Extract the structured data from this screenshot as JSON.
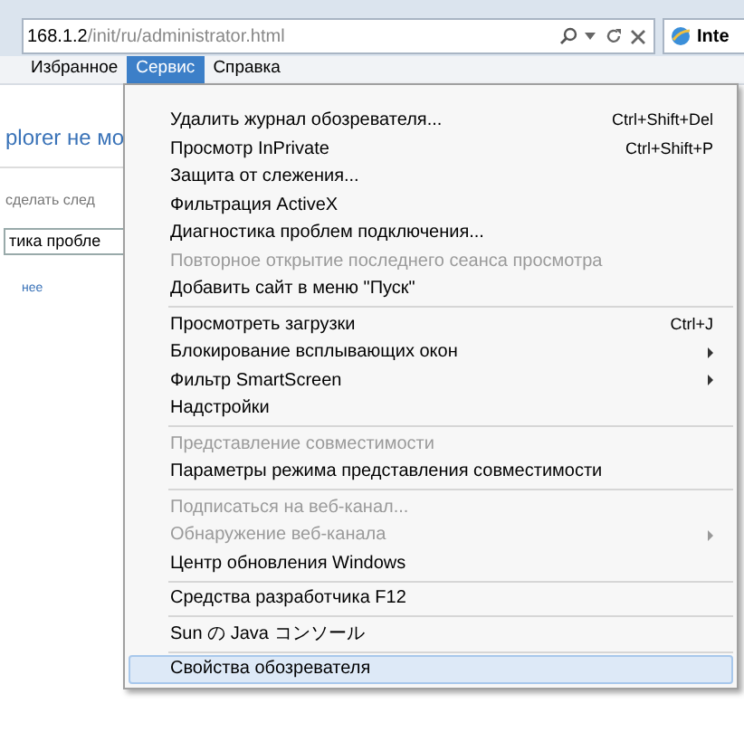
{
  "address_bar": {
    "url_host": "168.1.2",
    "url_path": "/init/ru/administrator.html"
  },
  "tab": {
    "title": "Inte"
  },
  "menu_bar": [
    {
      "label": "Избранное",
      "selected": false
    },
    {
      "label": "Сервис",
      "selected": true
    },
    {
      "label": "Справка",
      "selected": false
    }
  ],
  "page": {
    "texts": [
      {
        "kind": "heading",
        "text": "plorer не мо"
      },
      {
        "kind": "text",
        "text": "сделать след"
      },
      {
        "kind": "field",
        "text": "тика пробле"
      },
      {
        "kind": "link",
        "text": "нее"
      }
    ]
  },
  "menu": {
    "sections": [
      {
        "items": [
          {
            "label": "Удалить журнал обозревателя...",
            "shortcut": "Ctrl+Shift+Del",
            "disabled": false,
            "submenu": false,
            "selected": false
          },
          {
            "label": "Просмотр InPrivate",
            "shortcut": "Ctrl+Shift+P",
            "disabled": false,
            "submenu": false,
            "selected": false
          },
          {
            "label": "Защита от слежения...",
            "disabled": false,
            "submenu": false,
            "selected": false
          },
          {
            "label": "Фильтрация ActiveX",
            "disabled": false,
            "submenu": false,
            "selected": false
          },
          {
            "label": "Диагностика проблем подключения...",
            "disabled": false,
            "submenu": false,
            "selected": false
          },
          {
            "label": "Повторное открытие последнего сеанса просмотра",
            "disabled": true,
            "submenu": false,
            "selected": false
          },
          {
            "label": "Добавить сайт в меню \"Пуск\"",
            "disabled": false,
            "submenu": false,
            "selected": false
          }
        ]
      },
      {
        "items": [
          {
            "label": "Просмотреть загрузки",
            "shortcut": "Ctrl+J",
            "disabled": false,
            "submenu": false,
            "selected": false
          },
          {
            "label": "Блокирование всплывающих окон",
            "disabled": false,
            "submenu": true,
            "selected": false
          },
          {
            "label": "Фильтр SmartScreen",
            "disabled": false,
            "submenu": true,
            "selected": false
          },
          {
            "label": "Надстройки",
            "disabled": false,
            "submenu": false,
            "selected": false
          }
        ]
      },
      {
        "items": [
          {
            "label": "Представление совместимости",
            "disabled": true,
            "submenu": false,
            "selected": false
          },
          {
            "label": "Параметры режима представления совместимости",
            "disabled": false,
            "submenu": false,
            "selected": false
          }
        ]
      },
      {
        "items": [
          {
            "label": "Подписаться на веб-канал...",
            "disabled": true,
            "submenu": false,
            "selected": false
          },
          {
            "label": "Обнаружение веб-канала",
            "disabled": true,
            "submenu": true,
            "selected": false
          },
          {
            "label": "Центр обновления Windows",
            "disabled": false,
            "submenu": false,
            "selected": false
          }
        ]
      },
      {
        "items": [
          {
            "label": "Средства разработчика F12",
            "disabled": false,
            "submenu": false,
            "selected": false
          }
        ]
      },
      {
        "items": [
          {
            "label": "Sun の Java コンソール",
            "disabled": false,
            "submenu": false,
            "selected": false
          }
        ]
      },
      {
        "items": [
          {
            "label": "Свойства обозревателя",
            "disabled": false,
            "submenu": false,
            "selected": true
          }
        ]
      }
    ]
  }
}
